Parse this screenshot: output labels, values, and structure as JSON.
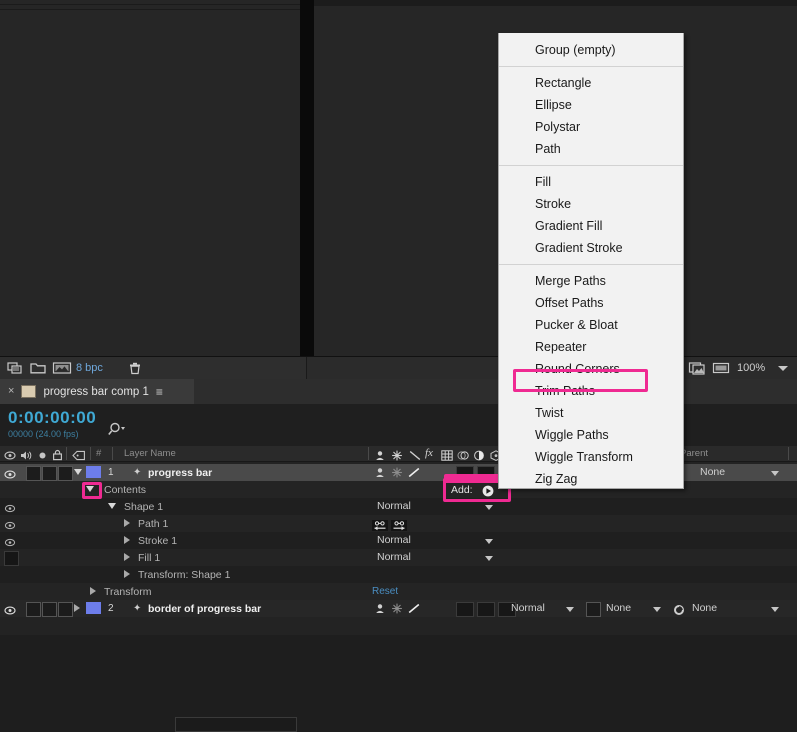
{
  "app": "After Effects",
  "viewer": {
    "bpc_label": "8 bpc",
    "zoom_level": "100%",
    "icons": {
      "comp_flowchart": "flowchart-icon",
      "folder": "folder-icon",
      "render_preview": "render-preview-icon",
      "trash": "trash-icon",
      "take_snapshot": "snapshot-icon",
      "show_snapshot": "show-snapshot-icon"
    }
  },
  "timeline": {
    "tab": {
      "close_label": "×",
      "comp_name": "progress bar comp 1",
      "menu_glyph": "≡"
    },
    "timecode": "0:00:00:00",
    "timecode_sub": "00000 (24.00 fps)",
    "search_icon": "search-icon",
    "columns": {
      "eye": "video-visibility-icon",
      "audio": "audio-icon",
      "solo": "solo-icon",
      "lock": "lock-icon",
      "label": "label-color-icon",
      "number": "#",
      "layer_name": "Layer Name",
      "parent": "Parent",
      "switches": [
        "shy-icon",
        "collapse-transformations-icon",
        "quality-icon",
        "effects-icon",
        "frame-blending-icon",
        "motion-blur-icon",
        "adjustment-layer-icon",
        "3d-layer-icon"
      ]
    },
    "rows": [
      {
        "num": "1",
        "name": "progress bar",
        "kind": "layer",
        "indent": 0,
        "selected": true,
        "mode": "",
        "parent": "None"
      },
      {
        "num": "",
        "name": "Contents",
        "kind": "group",
        "indent": 1,
        "selected": false,
        "add_label": "Add:"
      },
      {
        "num": "",
        "name": "Shape 1",
        "kind": "group",
        "indent": 2,
        "mode": "Normal"
      },
      {
        "num": "",
        "name": "Path 1",
        "kind": "prop",
        "indent": 3,
        "mode": ""
      },
      {
        "num": "",
        "name": "Stroke 1",
        "kind": "prop",
        "indent": 3,
        "mode": "Normal"
      },
      {
        "num": "",
        "name": "Fill 1",
        "kind": "prop",
        "indent": 3,
        "mode": "Normal"
      },
      {
        "num": "",
        "name": "Transform: Shape 1",
        "kind": "prop",
        "indent": 3,
        "mode": ""
      },
      {
        "num": "",
        "name": "Transform",
        "kind": "group",
        "indent": 1,
        "mode": "",
        "reset": "Reset"
      },
      {
        "num": "2",
        "name": "border of progress bar",
        "kind": "layer",
        "indent": 0,
        "selected": false,
        "mode": "Normal",
        "parent": "None"
      }
    ],
    "parent_values": {
      "row1": "None",
      "row9_a": "None",
      "row9_b": "None"
    },
    "add_button_label": "Add:"
  },
  "menu": {
    "title": "Add shape menu",
    "groups": [
      {
        "items": [
          "Group (empty)"
        ]
      },
      {
        "items": [
          "Rectangle",
          "Ellipse",
          "Polystar",
          "Path"
        ]
      },
      {
        "items": [
          "Fill",
          "Stroke",
          "Gradient Fill",
          "Gradient Stroke"
        ]
      },
      {
        "items": [
          "Merge Paths",
          "Offset Paths",
          "Pucker & Bloat",
          "Repeater",
          "Round Corners",
          "Trim Paths",
          "Twist",
          "Wiggle Paths",
          "Wiggle Transform",
          "Zig Zag"
        ]
      }
    ],
    "highlighted_item": "Trim Paths"
  },
  "highlights": {
    "color": "#ef2a92",
    "boxes": [
      "trim-paths-menu-item",
      "add-button",
      "contents-twirl-arrow",
      "layer-switch-cells"
    ]
  }
}
